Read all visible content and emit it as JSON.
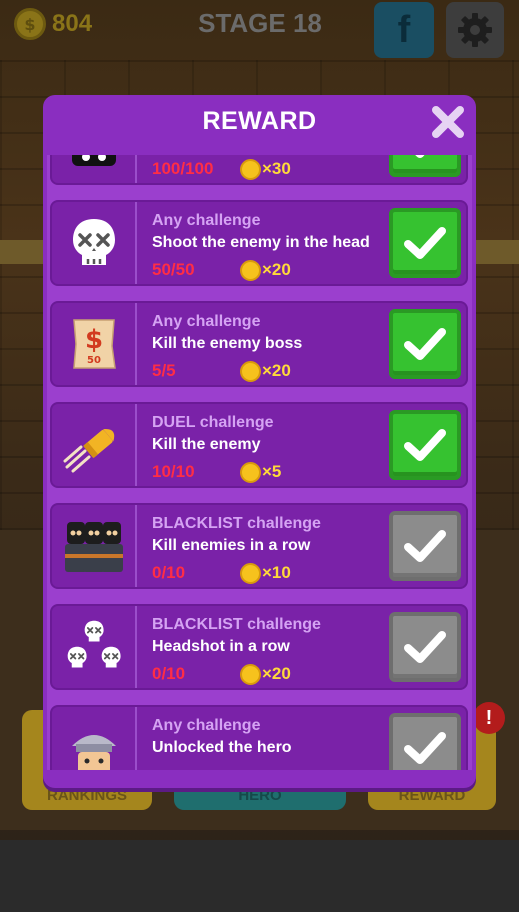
{
  "hud": {
    "coins": "804",
    "stage": "STAGE 18",
    "facebook_label": "f"
  },
  "background": {
    "left_button": "RANKINGS",
    "mid_button": "HERO",
    "right_button": "REWARD",
    "alert": "!"
  },
  "dialog": {
    "title": "REWARD",
    "items": [
      {
        "type": "",
        "desc": "",
        "progress": "100/100",
        "reward": "×30",
        "status": "complete",
        "icon": "masked-thief-icon"
      },
      {
        "type": "Any challenge",
        "desc": "Shoot the enemy in the head",
        "progress": "50/50",
        "reward": "×20",
        "status": "complete",
        "icon": "skull-icon"
      },
      {
        "type": "Any challenge",
        "desc": "Kill the enemy boss",
        "progress": "5/5",
        "reward": "×20",
        "status": "complete",
        "icon": "wanted-poster-icon"
      },
      {
        "type": "DUEL challenge",
        "desc": "Kill the enemy",
        "progress": "10/10",
        "reward": "×5",
        "status": "complete",
        "icon": "bullet-icon"
      },
      {
        "type": "BLACKLIST challenge",
        "desc": "Kill enemies in a row",
        "progress": "0/10",
        "reward": "×10",
        "status": "incomplete",
        "icon": "enemy-group-icon"
      },
      {
        "type": "BLACKLIST challenge",
        "desc": "Headshot in a row",
        "progress": "0/10",
        "reward": "×20",
        "status": "incomplete",
        "icon": "skull-pile-icon"
      },
      {
        "type": "Any challenge",
        "desc": "Unlocked the hero",
        "progress": "",
        "reward": "",
        "status": "incomplete",
        "icon": "hero-face-icon"
      }
    ]
  },
  "colors": {
    "panel": "#8a2ec0",
    "card": "#7a22a8",
    "progress": "#ff2d45",
    "reward": "#ffd93a",
    "check_done": "#36c230",
    "check_todo": "#8c8c8c"
  }
}
